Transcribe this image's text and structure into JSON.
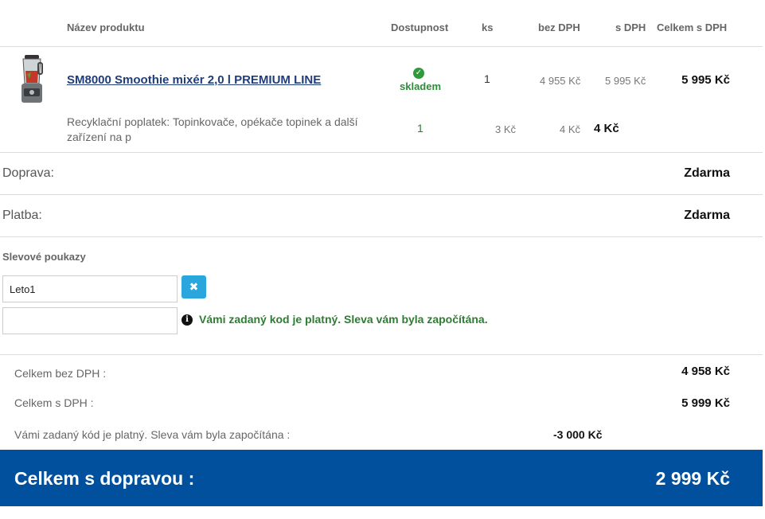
{
  "table_header": {
    "product_name": "Název produktu",
    "availability": "Dostupnost",
    "qty": "ks",
    "price_excl_vat": "bez DPH",
    "price_incl_vat": "s DPH",
    "total_incl_vat": "Celkem  s DPH"
  },
  "product": {
    "name": "SM8000 Smoothie mixér 2,0 l PREMIUM LINE",
    "availability_icon": "check-circle-icon",
    "availability": "skladem",
    "qty": "1",
    "price_excl_vat": "4 955 Kč",
    "price_incl_vat": "5 995 Kč",
    "total": "5 995 Kč"
  },
  "recycling_fee": {
    "label": "Recyklační poplatek:  Topinkovače, opékače topinek a další zařízení na p",
    "qty": "1",
    "price_excl_vat": "3 Kč",
    "price_incl_vat": "4 Kč",
    "total": "4 Kč"
  },
  "shipping": {
    "label": "Doprava:",
    "value": "Zdarma"
  },
  "payment": {
    "label": "Platba:",
    "value": "Zdarma"
  },
  "vouchers": {
    "title": "Slevové poukazy",
    "code_value": "Leto1",
    "second_value": "",
    "remove_icon": "close-icon",
    "info_icon": "info-icon",
    "message": "Vámi zadaný kod je platný. Sleva vám byla započítána."
  },
  "summary": {
    "total_excl_vat_label": "Celkem bez DPH :",
    "total_excl_vat_value": "4 958 Kč",
    "total_incl_vat_label": "Celkem s DPH :",
    "total_incl_vat_value": "5 999 Kč",
    "discount_label": "Vámi zadaný kód je platný. Sleva vám byla započítána :",
    "discount_value": "-3 000 Kč"
  },
  "footer": {
    "label": "Celkem  s dopravou :",
    "value": "2 999 Kč",
    "bg_color": "#00509e"
  }
}
